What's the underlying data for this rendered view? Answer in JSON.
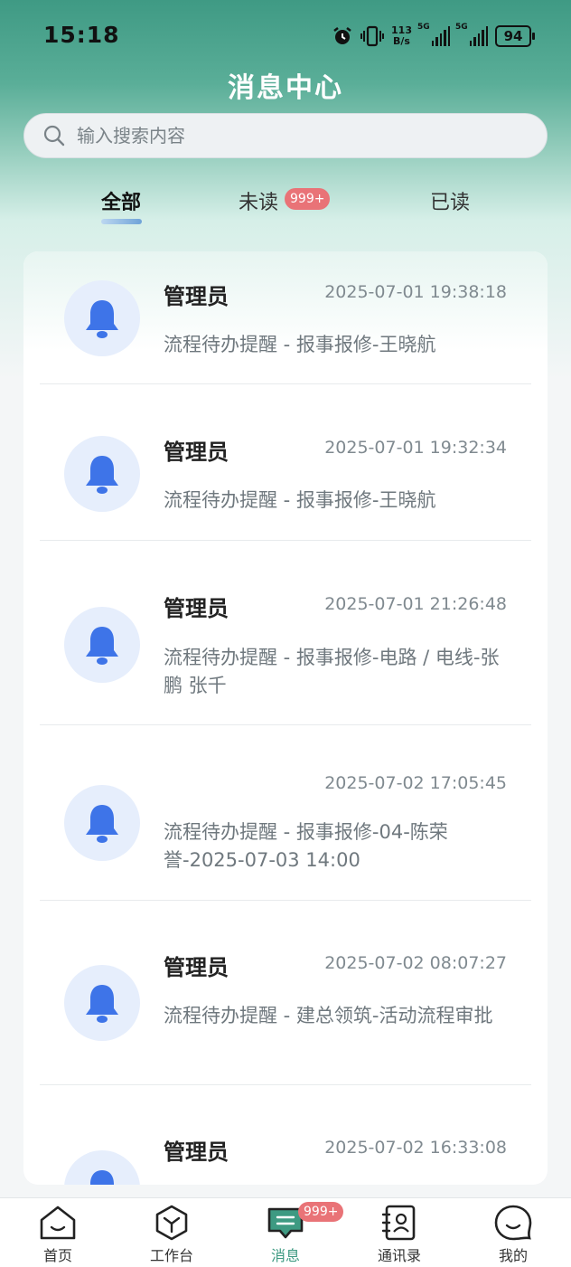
{
  "status": {
    "time": "15:18",
    "net_speed_value": "113",
    "net_speed_unit": "B/s",
    "signal1_label": "5G",
    "signal2_label": "5G",
    "battery": "94"
  },
  "header": {
    "title": "消息中心"
  },
  "search": {
    "placeholder": "输入搜索内容"
  },
  "tabs": {
    "all": "全部",
    "unread": "未读",
    "unread_badge": "999+",
    "read": "已读",
    "active": "all"
  },
  "messages": [
    {
      "sender": "管理员",
      "time": "2025-07-01 19:38:18",
      "text": "流程待办提醒 - 报事报修-王晓航",
      "icon": "bell-icon"
    },
    {
      "sender": "管理员",
      "time": "2025-07-01 19:32:34",
      "text": "流程待办提醒 - 报事报修-王晓航",
      "icon": "bell-icon"
    },
    {
      "sender": "管理员",
      "time": "2025-07-01 21:26:48",
      "text": "流程待办提醒 - 报事报修-电路 / 电线-张鹏 张千",
      "icon": "bell-icon"
    },
    {
      "sender": "",
      "time": "2025-07-02 17:05:45",
      "text": "流程待办提醒 - 报事报修-04-陈荣誉-2025-07-03 14:00",
      "icon": "bell-icon"
    },
    {
      "sender": "管理员",
      "time": "2025-07-02 08:07:27",
      "text": "流程待办提醒 - 建总领筑-活动流程审批",
      "icon": "bell-icon"
    },
    {
      "sender": "管理员",
      "time": "2025-07-02 16:33:08",
      "text": "",
      "icon": "bell-icon"
    }
  ],
  "nav": {
    "home": "首页",
    "workbench": "工作台",
    "messages": "消息",
    "messages_badge": "999+",
    "contacts": "通讯录",
    "mine": "我的"
  },
  "colors": {
    "accent": "#3e9a82",
    "badge": "#e97377",
    "bell": "#3e74e8"
  }
}
